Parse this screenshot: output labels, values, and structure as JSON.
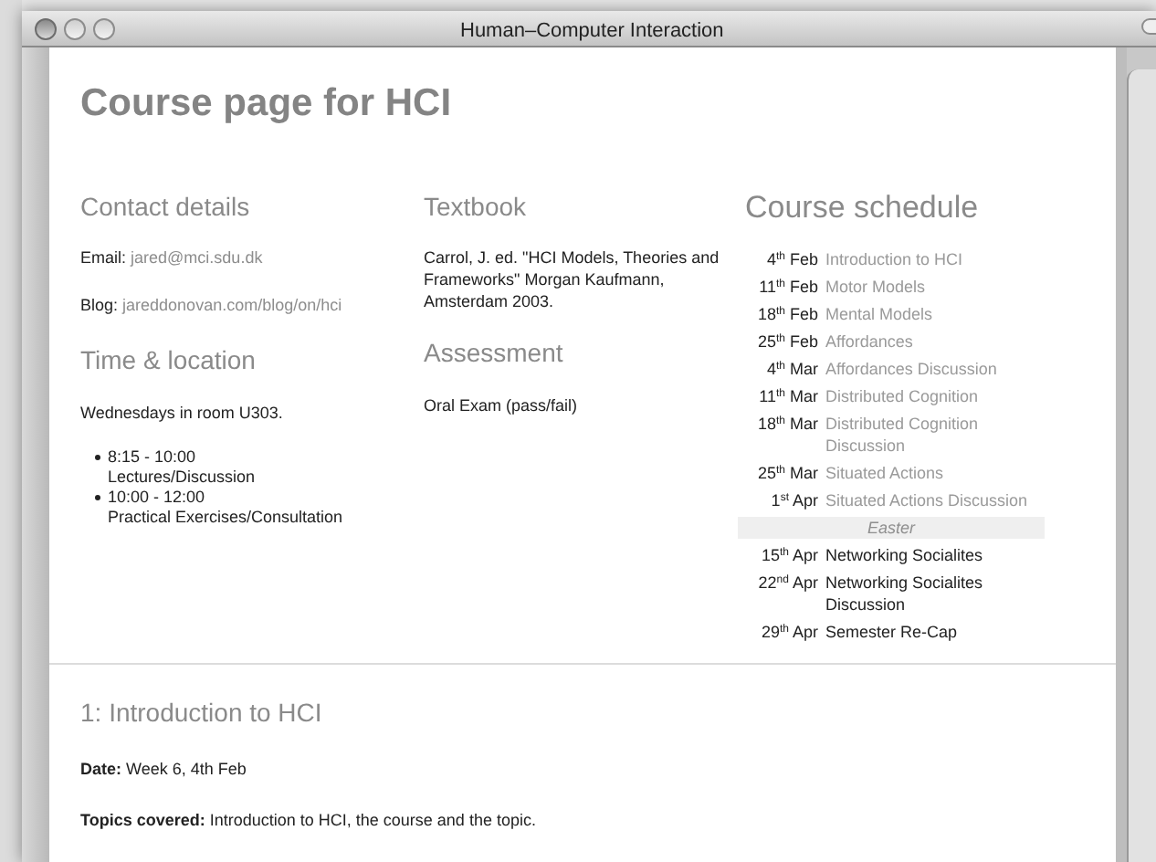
{
  "window": {
    "title": "Human–Computer Interaction"
  },
  "page_title": "Course page for HCI",
  "contact": {
    "heading": "Contact details",
    "lines": [
      {
        "label": "Email:",
        "value": "jared@mci.sdu.dk"
      },
      {
        "label": "Blog:",
        "value": "jareddonovan.com/blog/on/hci"
      }
    ]
  },
  "time_location": {
    "heading": "Time & location",
    "text": "Wednesdays in room U303.",
    "slots": [
      {
        "time": "8:15 - 10:00",
        "activity": "Lectures/Discussion"
      },
      {
        "time": "10:00 - 12:00",
        "activity": "Practical Exercises/Consultation"
      }
    ]
  },
  "textbook": {
    "heading": "Textbook",
    "text": "Carrol, J. ed. \"HCI Models, Theories and Frameworks\" Morgan Kaufmann, Amsterdam 2003."
  },
  "assessment": {
    "heading": "Assessment",
    "text": "Oral Exam (pass/fail)"
  },
  "schedule": {
    "heading": "Course schedule",
    "items": [
      {
        "kind": "lecture",
        "date": "4$^{th}$ Feb",
        "title": "Introduction to HCI",
        "linked": true
      },
      {
        "kind": "lecture",
        "date": "11$^{th}$ Feb",
        "title": "Motor Models",
        "linked": true
      },
      {
        "kind": "lecture",
        "date": "18$^{th}$ Feb",
        "title": "Mental Models",
        "linked": true
      },
      {
        "kind": "lecture",
        "date": "25$^{th}$ Feb",
        "title": "Affordances",
        "linked": true
      },
      {
        "kind": "lecture",
        "date": "4$^{th}$ Mar",
        "title": "Affordances Discussion",
        "linked": true
      },
      {
        "kind": "lecture",
        "date": "11$^{th}$ Mar",
        "title": "Distributed Cognition",
        "linked": true
      },
      {
        "kind": "lecture",
        "date": "18$^{th}$ Mar",
        "title": "Distributed Cognition Discussion",
        "linked": true
      },
      {
        "kind": "lecture",
        "date": "25$^{th}$ Mar",
        "title": "Situated Actions",
        "linked": true
      },
      {
        "kind": "lecture",
        "date": "1$^{st}$ Apr",
        "title": "Situated Actions Discussion",
        "linked": true
      },
      {
        "kind": "break",
        "title": "Easter"
      },
      {
        "kind": "lecture",
        "date": "15$^{th}$ Apr",
        "title": "Networking Socialites",
        "linked": false
      },
      {
        "kind": "lecture",
        "date": "22$^{nd}$ Apr",
        "title": "Networking Socialites Discussion",
        "linked": false
      },
      {
        "kind": "lecture",
        "date": "29$^{th}$ Apr",
        "title": "Semester Re-Cap",
        "linked": false
      }
    ]
  },
  "session": {
    "heading": "1: Introduction to HCI",
    "fields": [
      {
        "label": "Date:",
        "value": "Week 6, 4th Feb"
      },
      {
        "label": "Topics covered:",
        "value": "Introduction to HCI, the course and the topic."
      }
    ]
  }
}
